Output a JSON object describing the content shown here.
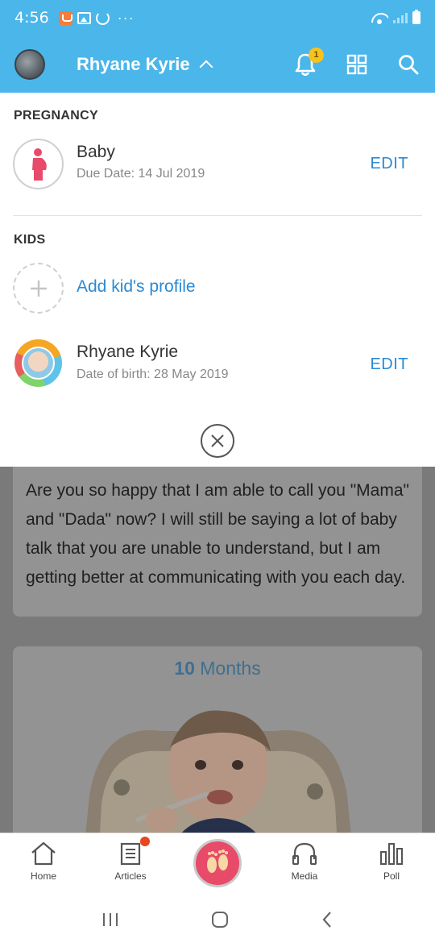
{
  "status_bar": {
    "time": "4:56",
    "more": "···"
  },
  "header": {
    "profile_name": "Rhyane Kyrie",
    "notification_count": "1"
  },
  "pregnancy": {
    "section_label": "PREGNANCY",
    "title": "Baby",
    "subtitle": "Due Date: 14 Jul 2019",
    "edit_label": "EDIT"
  },
  "kids": {
    "section_label": "KIDS",
    "add_label": "Add kid's profile",
    "items": [
      {
        "name": "Rhyane Kyrie",
        "dob": "Date of birth: 28 May 2019",
        "edit_label": "EDIT"
      }
    ]
  },
  "feed": {
    "message": "Are you so happy that I am able to call you \"Mama\" and \"Dada\" now?  I will still be saying a lot of baby talk that you are unable to understand, but I am getting better at communicating with you each day.",
    "age_number": "10",
    "age_unit": "Months"
  },
  "bottom_nav": {
    "home": "Home",
    "articles": "Articles",
    "media": "Media",
    "poll": "Poll"
  },
  "icons": {
    "notification": "bell-icon",
    "grid": "grid-icon",
    "search": "search-icon",
    "pregnancy": "pregnant-woman-icon",
    "add": "plus-icon",
    "close": "close-icon",
    "center": "footprints-icon"
  },
  "colors": {
    "header_bg": "#4ab6ea",
    "link": "#2a8ad4",
    "accent_pink": "#e84a6a",
    "badge": "#f7c31b"
  }
}
